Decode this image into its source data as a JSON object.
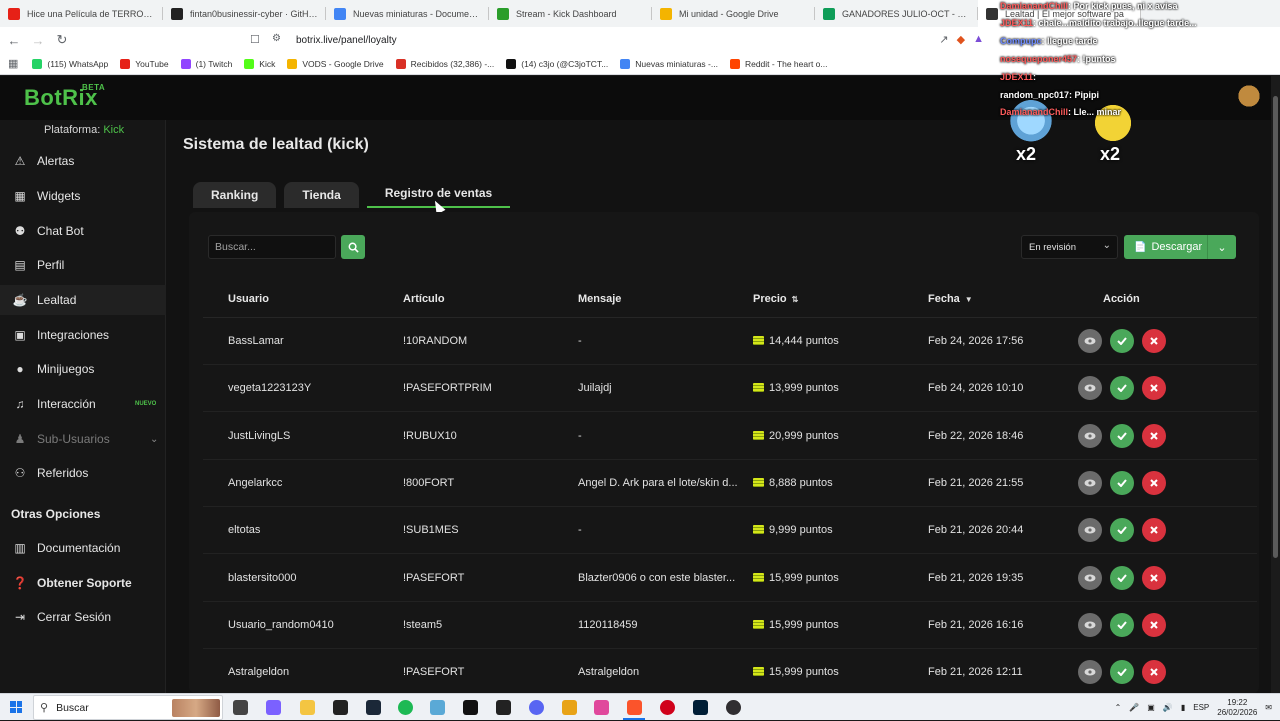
{
  "browser": {
    "tabs": [
      {
        "title": "Hice una Película de TERROR de $1",
        "color": "#e62117"
      },
      {
        "title": "fintan0businessir-cyber · GitHub",
        "color": "#222222"
      },
      {
        "title": "Nuevas miniaturas - Documentos de",
        "color": "#4285f4"
      },
      {
        "title": "Stream - Kick Dashboard",
        "color": "#2a9d2a"
      },
      {
        "title": "Mi unidad - Google Drive",
        "color": "#f4b400"
      },
      {
        "title": "GANADORES JULIO-OCT - Hojas de",
        "color": "#0f9d58"
      },
      {
        "title": "Lealtad | El mejor software pa",
        "color": "#333333"
      }
    ],
    "url": "botrix.live/panel/loyalty",
    "bookmarks": [
      {
        "label": "(115) WhatsApp",
        "color": "#25d366"
      },
      {
        "label": "YouTube",
        "color": "#e62117"
      },
      {
        "label": "(1) Twitch",
        "color": "#9146ff"
      },
      {
        "label": "Kick",
        "color": "#53fc18"
      },
      {
        "label": "VODS - Google Drive",
        "color": "#f4b400"
      },
      {
        "label": "Recibidos (32,386) -...",
        "color": "#d93025"
      },
      {
        "label": "(14) c3jo (@C3joTCT...",
        "color": "#111111"
      },
      {
        "label": "Nuevas miniaturas -...",
        "color": "#4285f4"
      },
      {
        "label": "Reddit - The heart o...",
        "color": "#ff4500"
      }
    ]
  },
  "app": {
    "logo": "BotRix",
    "logo_badge": "BETA",
    "platform_label": "Plataforma:",
    "platform_value": "Kick",
    "nav": [
      {
        "label": "Alertas",
        "icon": "warning-icon"
      },
      {
        "label": "Widgets",
        "icon": "widgets-icon"
      },
      {
        "label": "Chat Bot",
        "icon": "robot-icon"
      },
      {
        "label": "Perfil",
        "icon": "id-card-icon"
      },
      {
        "label": "Lealtad",
        "icon": "trophy-icon"
      },
      {
        "label": "Integraciones",
        "icon": "integrations-icon"
      },
      {
        "label": "Minijuegos",
        "icon": "gamepad-icon"
      },
      {
        "label": "Interacción",
        "icon": "music-icon"
      },
      {
        "label": "Sub-Usuarios",
        "icon": "users-icon"
      },
      {
        "label": "Referidos",
        "icon": "referrals-icon"
      }
    ],
    "nav_badge_new": "NUEVO",
    "other_options_title": "Otras Opciones",
    "other_nav": [
      {
        "label": "Documentación",
        "icon": "document-icon"
      },
      {
        "label": "Obtener Soporte",
        "icon": "help-icon"
      },
      {
        "label": "Cerrar Sesión",
        "icon": "logout-icon"
      }
    ]
  },
  "page": {
    "title": "Sistema de lealtad (kick)",
    "tabs": [
      "Ranking",
      "Tienda",
      "Registro de ventas"
    ],
    "search_placeholder": "Buscar...",
    "status_filter": "En revisión",
    "download_label": "Descargar",
    "columns": [
      "Usuario",
      "Artículo",
      "Mensaje",
      "Precio",
      "Fecha",
      "Acción"
    ],
    "rows": [
      {
        "user": "BassLamar",
        "item": "!10RANDOM",
        "message": "-",
        "price": "14,444 puntos",
        "date": "Feb 24, 2026 17:56"
      },
      {
        "user": "vegeta1223123Y",
        "item": "!PASEFORTPRIM",
        "message": "Juilajdj",
        "price": "13,999 puntos",
        "date": "Feb 24, 2026 10:10"
      },
      {
        "user": "JustLivingLS",
        "item": "!RUBUX10",
        "message": "-",
        "price": "20,999 puntos",
        "date": "Feb 22, 2026 18:46"
      },
      {
        "user": "Angelarkcc",
        "item": "!800FORT",
        "message": "Angel D. Ark para el lote/skin d...",
        "price": "8,888 puntos",
        "date": "Feb 21, 2026 21:55"
      },
      {
        "user": "eltotas",
        "item": "!SUB1MES",
        "message": "-",
        "price": "9,999 puntos",
        "date": "Feb 21, 2026 20:44"
      },
      {
        "user": "blastersito000",
        "item": "!PASEFORT",
        "message": "Blazter0906 o con este blaster...",
        "price": "15,999 puntos",
        "date": "Feb 21, 2026 19:35"
      },
      {
        "user": "Usuario_random0410",
        "item": "!steam5",
        "message": "1120118459",
        "price": "15,999 puntos",
        "date": "Feb 21, 2026 16:16"
      },
      {
        "user": "Astralgeldon",
        "item": "!PASEFORT",
        "message": "Astralgeldon",
        "price": "15,999 puntos",
        "date": "Feb 21, 2026 12:11"
      }
    ]
  },
  "overlay": {
    "lines": [
      {
        "name": "DamianandChill",
        "text": ": Por kick pues, ni x avisa",
        "color": "#ff5c5c"
      },
      {
        "name": "JDEX11",
        "text": ": chale...maldito trabajo..llegue tarde...",
        "color": "#ff5c5c"
      },
      {
        "name": "Compupc",
        "text": ": llegue tarde",
        "color": "#6f8cff"
      },
      {
        "name": "nosequeponer457",
        "text": ": !puntos",
        "color": "#ff5c5c"
      },
      {
        "name": "JDEX11",
        "text": ":",
        "color": "#ff5c5c"
      },
      {
        "name": "random_npc017",
        "text": ": Pipipi",
        "color": "#ffffff"
      },
      {
        "name": "DamianandChill",
        "text": ": Lle... minar",
        "color": "#ff5c5c"
      }
    ],
    "multiplier": "x2"
  },
  "taskbar": {
    "search": "Buscar",
    "lang": "ESP",
    "time": "19:22",
    "date": "26/02/2026"
  }
}
